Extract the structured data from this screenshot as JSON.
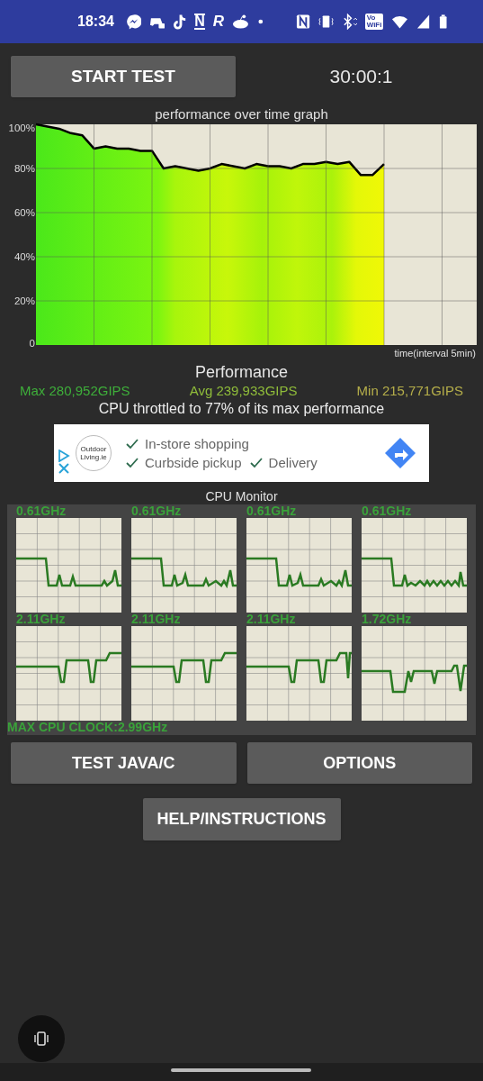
{
  "status_bar": {
    "time": "18:34",
    "app_glyphs": [
      "N",
      "R"
    ],
    "vowifi": [
      "Vo",
      "WiFi"
    ]
  },
  "start_button": "START TEST",
  "timer": "30:00:1",
  "performance_graph": {
    "chart_data": {
      "type": "line",
      "grid": true,
      "title": "performance over time graph",
      "xlabel": "time(interval 5min)",
      "ylim": [
        0,
        100
      ],
      "yticks": [
        {
          "value": 0,
          "label": "0"
        },
        {
          "value": 20,
          "label": "20%"
        },
        {
          "value": 40,
          "label": "40%"
        },
        {
          "value": 60,
          "label": "60%"
        },
        {
          "value": 80,
          "label": "80%"
        },
        {
          "value": 100,
          "label": "100%"
        }
      ],
      "series": [
        {
          "color": "#000000",
          "values": [
            100,
            99,
            98,
            96,
            95,
            89,
            90,
            89,
            89,
            88,
            88,
            80,
            81,
            80,
            79,
            80,
            82,
            81,
            80,
            82,
            81,
            81,
            80,
            82,
            82,
            83,
            82,
            83,
            77,
            77,
            82
          ]
        }
      ]
    }
  },
  "performance": {
    "heading": "Performance",
    "max": "Max 280,952GIPS",
    "avg": "Avg 239,933GIPS",
    "min": "Min 215,771GIPS",
    "throttle": "CPU throttled to 77% of its max performance"
  },
  "ad": {
    "logo": "Outdoor Living.ie",
    "features": [
      "In-store shopping",
      "Curbside pickup",
      "Delivery"
    ]
  },
  "cpu_monitor": {
    "title": "CPU Monitor",
    "cores": [
      {
        "label": "0.61GHz"
      },
      {
        "label": "0.61GHz"
      },
      {
        "label": "0.61GHz"
      },
      {
        "label": "0.61GHz"
      },
      {
        "label": "2.11GHz"
      },
      {
        "label": "2.11GHz"
      },
      {
        "label": "2.11GHz"
      },
      {
        "label": "1.72GHz"
      }
    ],
    "max_clock": "MAX CPU CLOCK:2.99GHz"
  },
  "buttons": [
    "TEST JAVA/C",
    "OPTIONS"
  ],
  "help_button": "HELP/INSTRUCTIONS"
}
